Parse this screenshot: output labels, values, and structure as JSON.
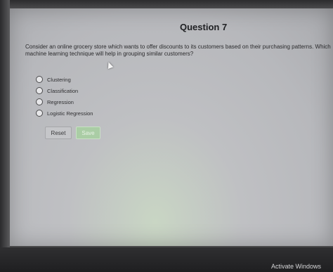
{
  "question": {
    "title": "Question 7",
    "line1": "Consider an online grocery store which wants to offer discounts to its customers based on their purchasing patterns. Which o",
    "line2": "machine learning technique will help in grouping similar customers?",
    "options": [
      {
        "label": "Clustering"
      },
      {
        "label": "Classification"
      },
      {
        "label": "Regression"
      },
      {
        "label": "Logistic Regression"
      }
    ]
  },
  "buttons": {
    "reset_label": "Reset",
    "save_label": "Save"
  },
  "os": {
    "watermark": "Activate Windows"
  }
}
